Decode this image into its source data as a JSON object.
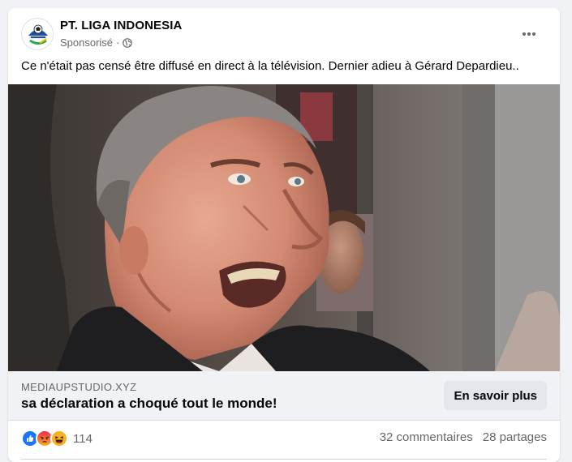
{
  "post": {
    "page_name": "PT. LIGA INDONESIA",
    "sponsored_label": "Sponsorisé",
    "separator": "·",
    "privacy_icon": "globe-icon",
    "text": "Ce n'était pas censé être diffusé en direct à la télévision. Dernier adieu à Gérard Depardieu.."
  },
  "link": {
    "domain": "MEDIAUPSTUDIO.XYZ",
    "headline": "sa déclaration a choqué tout le monde!",
    "cta_label": "En savoir plus"
  },
  "engagement": {
    "reaction_icons": [
      "like-icon",
      "angry-icon",
      "haha-icon"
    ],
    "reaction_count": "114",
    "comments": "32 commentaires",
    "shares": "28 partages"
  },
  "colors": {
    "like": "#1877f2",
    "angry": "#f0284a",
    "haha": "#f7b125",
    "cta_bg": "#e4e6eb",
    "link_bar_bg": "#f0f2f5"
  }
}
